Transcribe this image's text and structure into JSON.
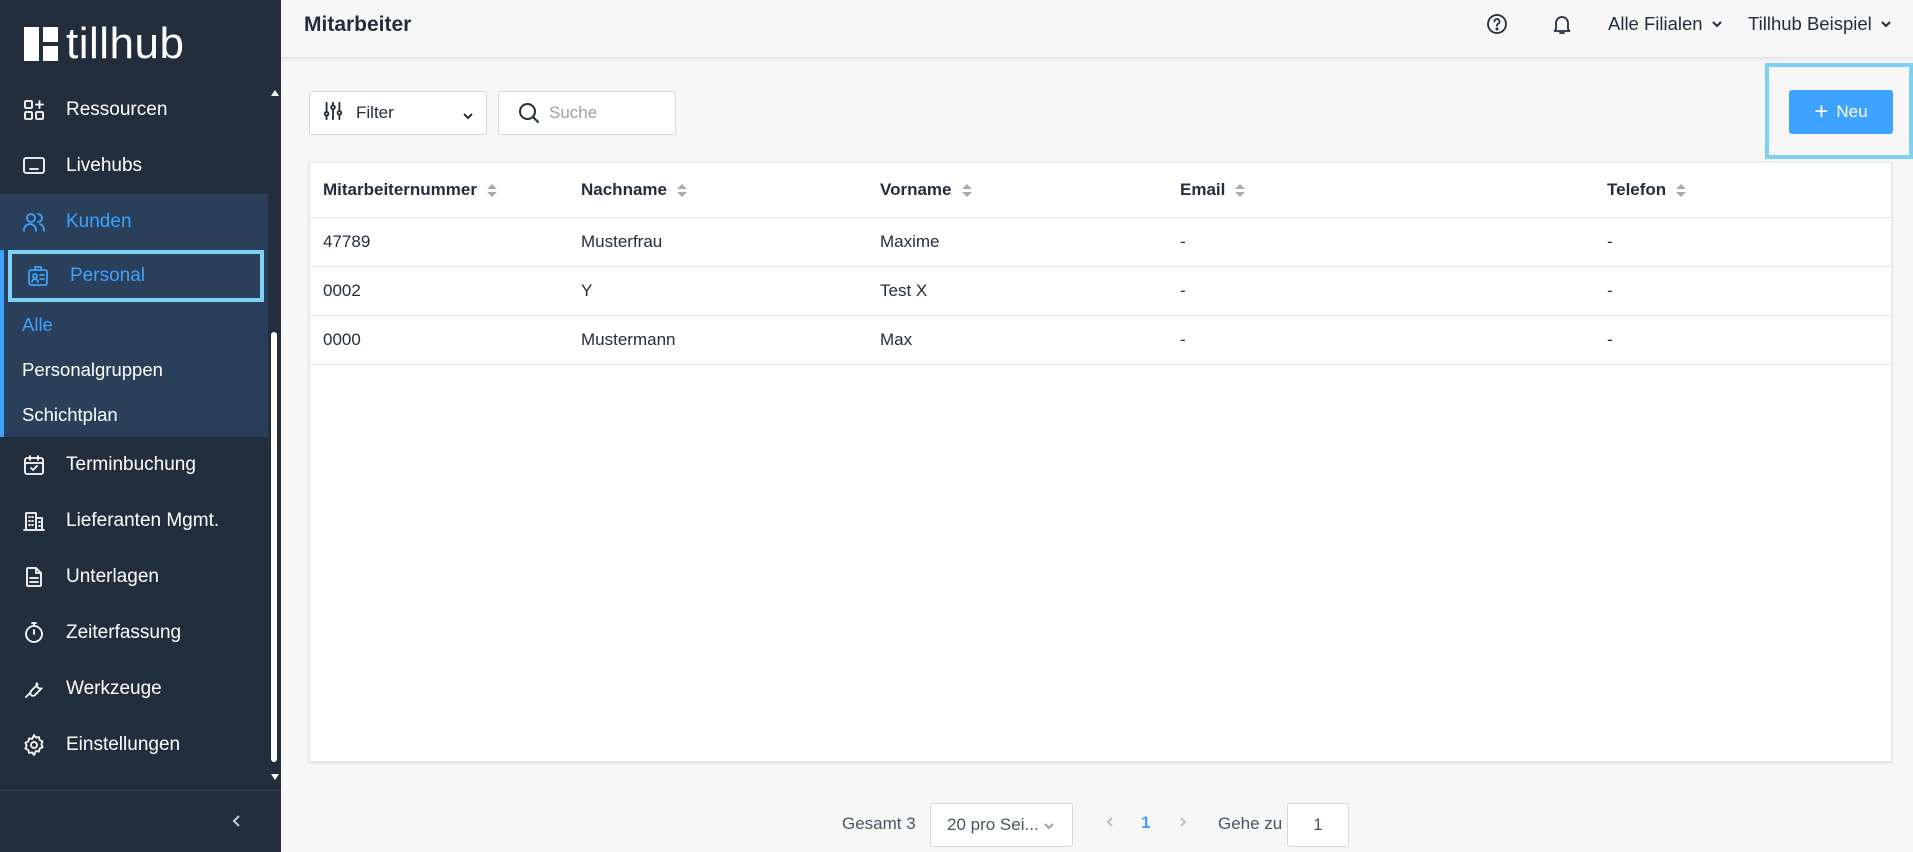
{
  "brand": {
    "name": "tillhub"
  },
  "sidebar": {
    "items": [
      {
        "label": "Ressourcen",
        "icon": "resources-icon"
      },
      {
        "label": "Livehubs",
        "icon": "monitor-icon"
      },
      {
        "label": "Kunden",
        "icon": "users-icon"
      },
      {
        "label": "Personal",
        "icon": "staff-badge-icon"
      },
      {
        "label": "Terminbuchung",
        "icon": "calendar-check-icon"
      },
      {
        "label": "Lieferanten Mgmt.",
        "icon": "building-icon"
      },
      {
        "label": "Unterlagen",
        "icon": "document-icon"
      },
      {
        "label": "Zeiterfassung",
        "icon": "stopwatch-icon"
      },
      {
        "label": "Werkzeuge",
        "icon": "wrench-icon"
      },
      {
        "label": "Einstellungen",
        "icon": "gear-icon"
      }
    ],
    "subitems": [
      {
        "label": "Alle",
        "current": true
      },
      {
        "label": "Personalgruppen",
        "current": false
      },
      {
        "label": "Schichtplan",
        "current": false
      }
    ]
  },
  "header": {
    "title": "Mitarbeiter",
    "branch_selector": "Alle Filialen",
    "account_selector": "Tillhub Beispiel"
  },
  "toolbar": {
    "filter_label": "Filter",
    "search_placeholder": "Suche",
    "new_label": "Neu"
  },
  "table": {
    "columns": [
      "Mitarbeiternummer",
      "Nachname",
      "Vorname",
      "Email",
      "Telefon"
    ],
    "rows": [
      [
        "47789",
        "Musterfrau",
        "Maxime",
        "-",
        "-"
      ],
      [
        "0002",
        "Y",
        "Test X",
        "-",
        "-"
      ],
      [
        "0000",
        "Mustermann",
        "Max",
        "-",
        "-"
      ]
    ]
  },
  "pagination": {
    "total_label": "Gesamt 3",
    "page_size": "20 pro Sei...",
    "current_page": "1",
    "goto_label": "Gehe zu",
    "goto_value": "1"
  },
  "colors": {
    "sidebar_bg": "#232e3d",
    "accent": "#3ea3ff",
    "highlight_frame": "#7dd1f5"
  }
}
